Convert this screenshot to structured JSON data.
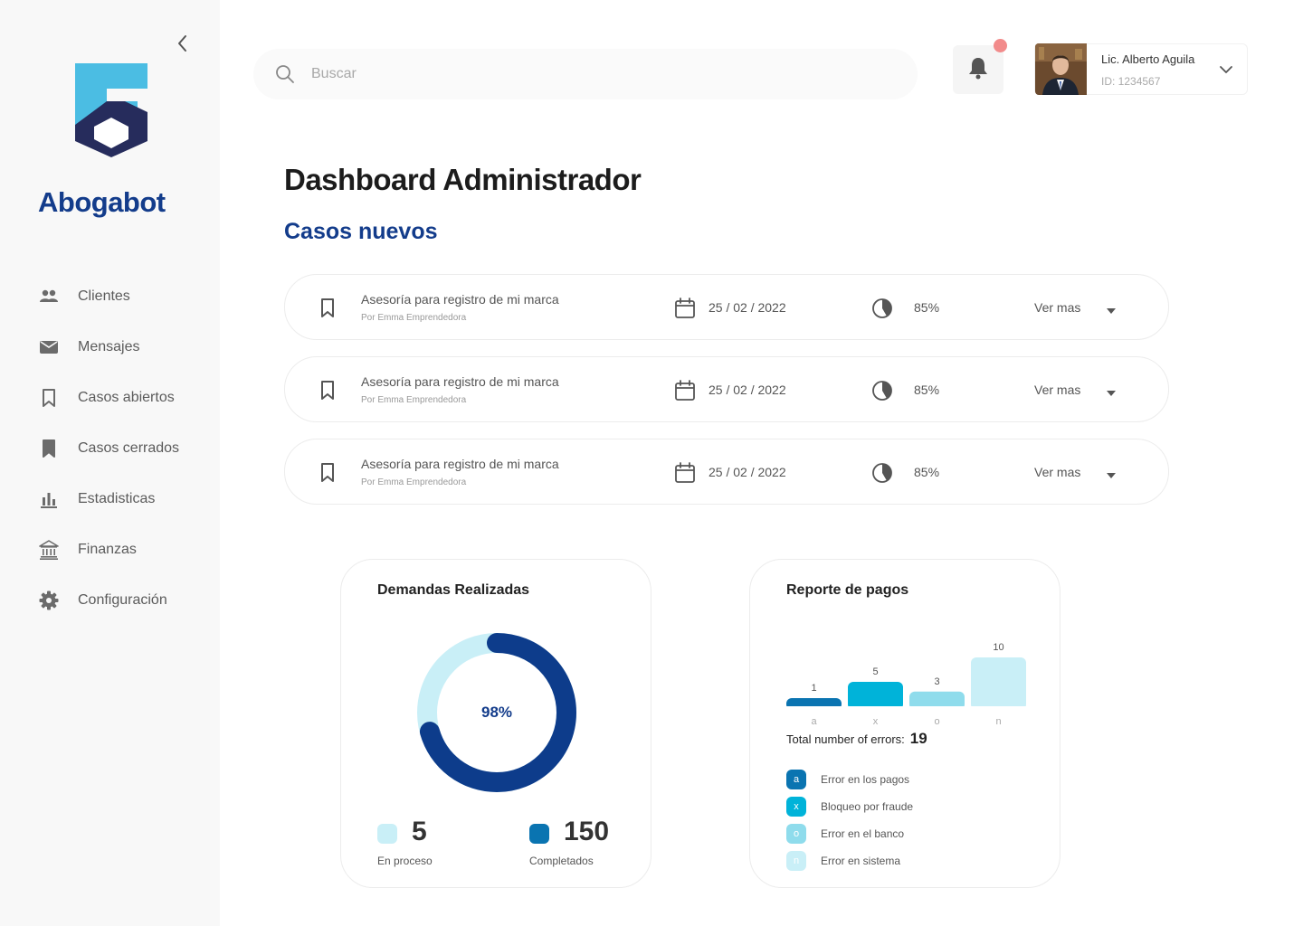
{
  "brand": {
    "name": "Abogabot",
    "color": "#133c8b",
    "logo_light": "#4bbde3",
    "logo_dark": "#262c5c"
  },
  "sidebar": {
    "items": [
      {
        "label": "Clientes",
        "icon": "people-icon"
      },
      {
        "label": "Mensajes",
        "icon": "envelope-icon"
      },
      {
        "label": "Casos abiertos",
        "icon": "bookmark-outline-icon"
      },
      {
        "label": "Casos cerrados",
        "icon": "bookmark-filled-icon"
      },
      {
        "label": "Estadisticas",
        "icon": "bar-chart-icon"
      },
      {
        "label": "Finanzas",
        "icon": "bank-icon"
      },
      {
        "label": "Configuración",
        "icon": "gear-icon"
      }
    ]
  },
  "search": {
    "placeholder": "Buscar",
    "value": ""
  },
  "profile": {
    "name": "Lic. Alberto Aguila",
    "id": "ID: 1234567"
  },
  "main": {
    "title": "Dashboard Administrador",
    "section_title": "Casos nuevos",
    "cases": [
      {
        "title": "Asesoría para registro de mi marca",
        "author": "Por Emma Emprendedora",
        "date": "25 / 02 / 2022",
        "progress": "85%",
        "action": "Ver mas"
      },
      {
        "title": "Asesoría para registro de mi marca",
        "author": "Por Emma Emprendedora",
        "date": "25 / 02 / 2022",
        "progress": "85%",
        "action": "Ver mas"
      },
      {
        "title": "Asesoría para registro de mi marca",
        "author": "Por Emma Emprendedora",
        "date": "25 / 02 / 2022",
        "progress": "85%",
        "action": "Ver mas"
      }
    ]
  },
  "demandas": {
    "title": "Demandas Realizadas",
    "percent_label": "98%",
    "percent_value": 0.98,
    "ring_color": "#0d3c8b",
    "track_color": "#c9eff7",
    "stats": [
      {
        "value": "5",
        "caption": "En proceso",
        "color": "#c9eff7"
      },
      {
        "value": "150",
        "caption": "Completados",
        "color": "#0a74b1"
      }
    ]
  },
  "pagos": {
    "title": "Reporte de pagos",
    "total_label": "Total number of errors:",
    "total_value": "19",
    "legend": [
      {
        "key": "a",
        "label": "Error en los pagos",
        "color": "#0a74b1"
      },
      {
        "key": "x",
        "label": "Bloqueo por fraude",
        "color": "#00b3d9"
      },
      {
        "key": "o",
        "label": "Error en el banco",
        "color": "#8fdcec"
      },
      {
        "key": "n",
        "label": "Error en sistema",
        "color": "#c9eff7"
      }
    ]
  },
  "chart_data": {
    "type": "bar",
    "categories": [
      "a",
      "x",
      "o",
      "n"
    ],
    "values": [
      1,
      5,
      3,
      10
    ],
    "colors": [
      "#0a74b1",
      "#00b3d9",
      "#8fdcec",
      "#c9eff7"
    ],
    "title": "Reporte de pagos",
    "xlabel": "",
    "ylabel": "",
    "ylim": [
      0,
      10
    ]
  }
}
